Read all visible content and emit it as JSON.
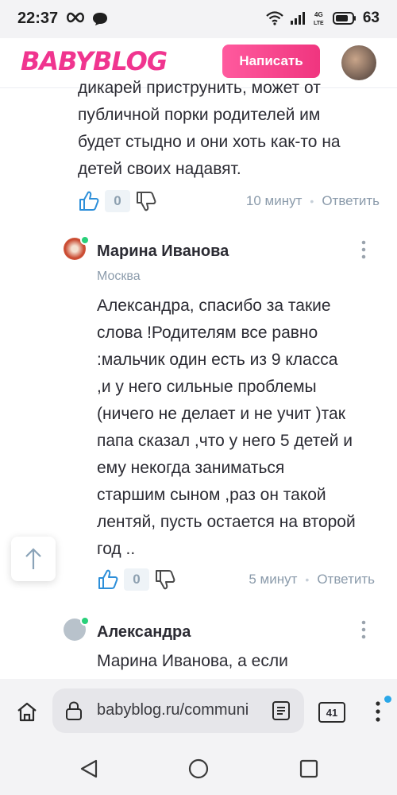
{
  "status_bar": {
    "time": "22:37",
    "battery": "63",
    "network": "4G LTE"
  },
  "header": {
    "logo": "BABYBLOG",
    "write_button": "Написать",
    "brand_color": "#f0358f"
  },
  "comments": [
    {
      "text_lines": [
        "дикарей приструнить, может от",
        "публичной порки родителей им",
        "будет стыдно и они хоть как-то на",
        "детей своих надавят."
      ],
      "likes": "0",
      "time": "10 минут",
      "reply": "Ответить"
    },
    {
      "author": "Марина Иванова",
      "city": "Москва",
      "text_lines": [
        "Александра, спасибо за такие",
        "слова !Родителям все равно",
        ":мальчик один есть из 9 класса",
        ",и у него сильные проблемы",
        "(ничего не делает и не учит )так",
        "папа сказал ,что у него 5 детей и",
        "ему некогда заниматься",
        "старшим сыном ,раз он такой",
        "лентяй, пусть остается на второй",
        "год .."
      ],
      "likes": "0",
      "time": "5 минут",
      "reply": "Ответить"
    },
    {
      "author": "Александра",
      "text_lines": [
        "Марина Иванова, а если"
      ]
    }
  ],
  "browser": {
    "url": "babyblog.ru/communi",
    "tab_count": "41"
  },
  "icons": [
    "like-icon",
    "dislike-icon",
    "more-icon",
    "arrow-up-icon",
    "home-icon",
    "lock-icon",
    "reader-icon",
    "tabs-icon",
    "menu-icon",
    "back-icon",
    "home-nav-icon",
    "recents-icon"
  ]
}
